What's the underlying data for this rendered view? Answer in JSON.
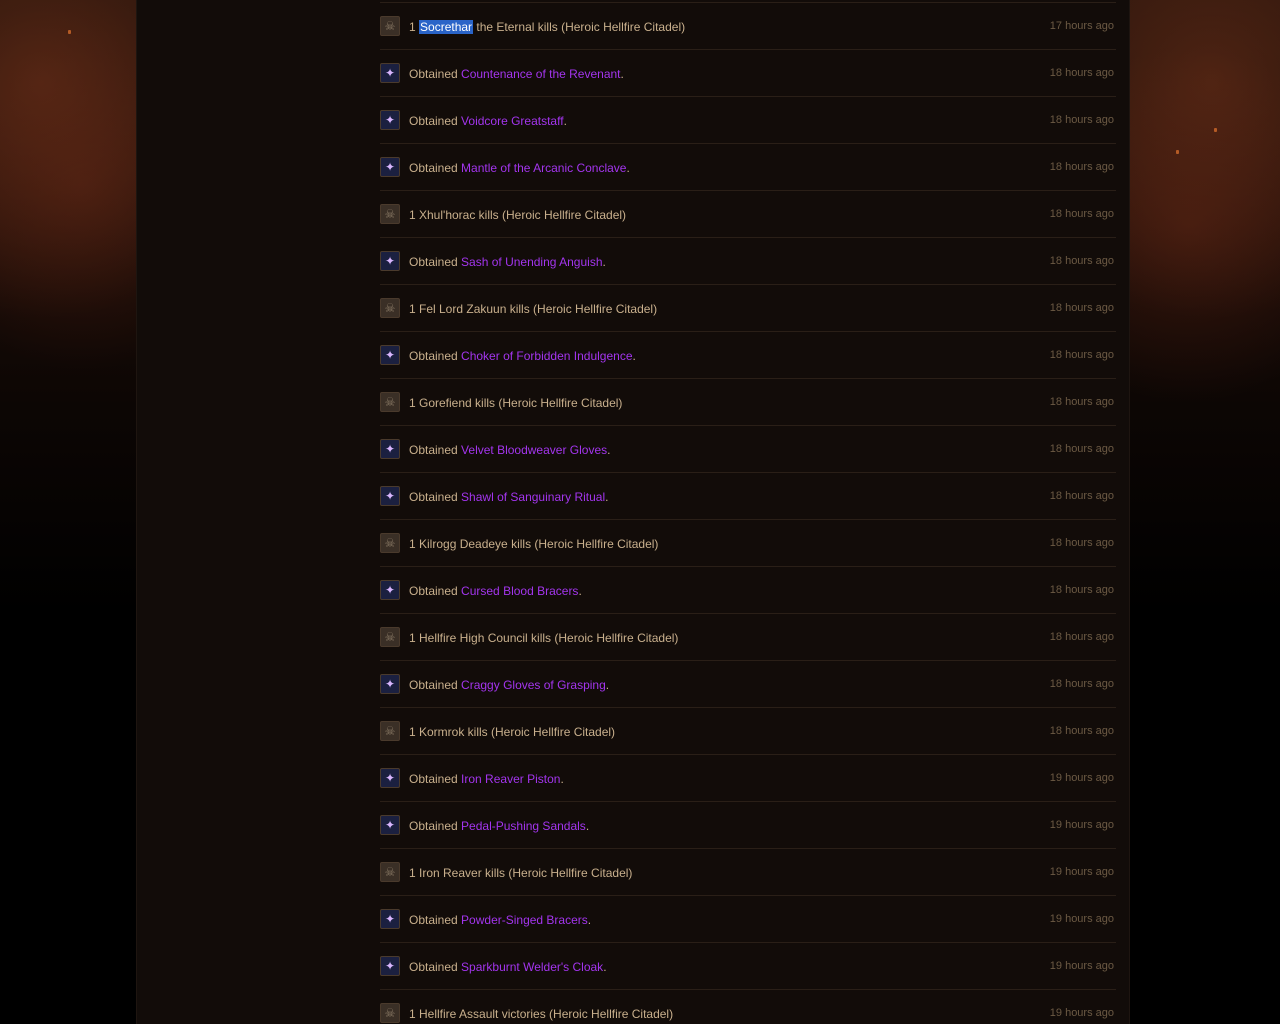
{
  "colors": {
    "text": "#c9b08d",
    "item_epic": "#a335ee",
    "timestamp": "#6c5a44",
    "divider": "#2a1f17",
    "content_bg": "#120c09",
    "selection": "#2a64c8"
  },
  "feed": [
    {
      "kind": "kill",
      "icon": "skull-icon",
      "pre": "1 ",
      "highlight": "Socrethar",
      "post": " the Eternal kills (Heroic Hellfire Citadel)",
      "time": "17 hours ago"
    },
    {
      "kind": "loot",
      "icon": "item-icon",
      "pre": "Obtained ",
      "item": "Countenance of the Revenant",
      "post": ".",
      "time": "18 hours ago"
    },
    {
      "kind": "loot",
      "icon": "item-icon",
      "pre": "Obtained ",
      "item": "Voidcore Greatstaff",
      "post": ".",
      "time": "18 hours ago"
    },
    {
      "kind": "loot",
      "icon": "item-icon",
      "pre": "Obtained ",
      "item": "Mantle of the Arcanic Conclave",
      "post": ".",
      "time": "18 hours ago"
    },
    {
      "kind": "kill",
      "icon": "skull-icon",
      "pre": "1 Xhul'horac kills (Heroic Hellfire Citadel)",
      "time": "18 hours ago"
    },
    {
      "kind": "loot",
      "icon": "item-icon",
      "pre": "Obtained ",
      "item": "Sash of Unending Anguish",
      "post": ".",
      "time": "18 hours ago"
    },
    {
      "kind": "kill",
      "icon": "skull-icon",
      "pre": "1 Fel Lord Zakuun kills (Heroic Hellfire Citadel)",
      "time": "18 hours ago"
    },
    {
      "kind": "loot",
      "icon": "item-icon",
      "pre": "Obtained ",
      "item": "Choker of Forbidden Indulgence",
      "post": ".",
      "time": "18 hours ago"
    },
    {
      "kind": "kill",
      "icon": "skull-icon",
      "pre": "1 Gorefiend kills (Heroic Hellfire Citadel)",
      "time": "18 hours ago"
    },
    {
      "kind": "loot",
      "icon": "item-icon",
      "pre": "Obtained ",
      "item": "Velvet Bloodweaver Gloves",
      "post": ".",
      "time": "18 hours ago"
    },
    {
      "kind": "loot",
      "icon": "item-icon",
      "pre": "Obtained ",
      "item": "Shawl of Sanguinary Ritual",
      "post": ".",
      "time": "18 hours ago"
    },
    {
      "kind": "kill",
      "icon": "skull-icon",
      "pre": "1 Kilrogg Deadeye kills (Heroic Hellfire Citadel)",
      "time": "18 hours ago"
    },
    {
      "kind": "loot",
      "icon": "item-icon",
      "pre": "Obtained ",
      "item": "Cursed Blood Bracers",
      "post": ".",
      "time": "18 hours ago"
    },
    {
      "kind": "kill",
      "icon": "skull-icon",
      "pre": "1 Hellfire High Council kills (Heroic Hellfire Citadel)",
      "time": "18 hours ago"
    },
    {
      "kind": "loot",
      "icon": "item-icon",
      "pre": "Obtained ",
      "item": "Craggy Gloves of Grasping",
      "post": ".",
      "time": "18 hours ago"
    },
    {
      "kind": "kill",
      "icon": "skull-icon",
      "pre": "1 Kormrok kills (Heroic Hellfire Citadel)",
      "time": "18 hours ago"
    },
    {
      "kind": "loot",
      "icon": "item-icon",
      "pre": "Obtained ",
      "item": "Iron Reaver Piston",
      "post": ".",
      "time": "19 hours ago"
    },
    {
      "kind": "loot",
      "icon": "item-icon",
      "pre": "Obtained ",
      "item": "Pedal-Pushing Sandals",
      "post": ".",
      "time": "19 hours ago"
    },
    {
      "kind": "kill",
      "icon": "skull-icon",
      "pre": "1 Iron Reaver kills (Heroic Hellfire Citadel)",
      "time": "19 hours ago"
    },
    {
      "kind": "loot",
      "icon": "item-icon",
      "pre": "Obtained ",
      "item": "Powder-Singed Bracers",
      "post": ".",
      "time": "19 hours ago"
    },
    {
      "kind": "loot",
      "icon": "item-icon",
      "pre": "Obtained ",
      "item": "Sparkburnt Welder's Cloak",
      "post": ".",
      "time": "19 hours ago"
    },
    {
      "kind": "kill",
      "icon": "skull-icon",
      "pre": "1 Hellfire Assault victories (Heroic Hellfire Citadel)",
      "time": "19 hours ago"
    }
  ]
}
